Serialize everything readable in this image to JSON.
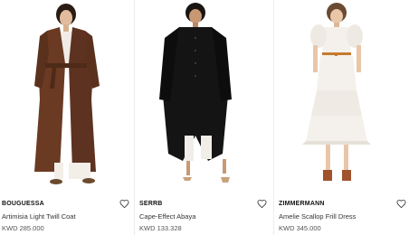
{
  "products": [
    {
      "brand": "BOUGUESSA",
      "name": "Artimisia Light Twill Coat",
      "price": "KWD 285.000",
      "image": "brown-long-coat-model",
      "wishlist_icon": "heart-outline-icon"
    },
    {
      "brand": "SERRB",
      "name": "Cape-Effect Abaya",
      "price": "KWD 133.328",
      "image": "black-abaya-model",
      "wishlist_icon": "heart-outline-icon"
    },
    {
      "brand": "ZIMMERMANN",
      "name": "Amelie Scallop Frill Dress",
      "price": "KWD 345.000",
      "image": "white-frill-dress-model",
      "wishlist_icon": "heart-outline-icon"
    }
  ],
  "colors": {
    "background": "#ffffff",
    "coat": "#6b3a22",
    "abaya": "#141414",
    "dress": "#f4f1ec",
    "belt": "#c67a2c"
  }
}
